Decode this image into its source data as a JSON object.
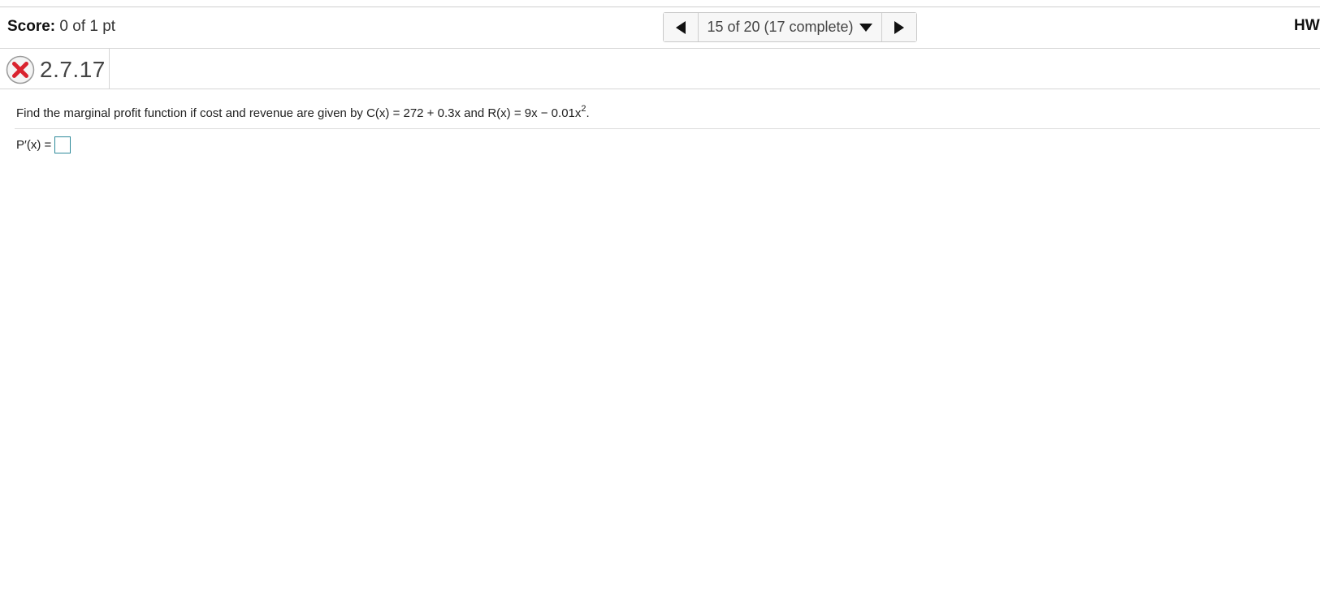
{
  "header": {
    "score_label": "Score:",
    "score_value": "0 of 1 pt",
    "nav": {
      "position_text": "15 of 20 (17 complete)"
    },
    "hw_label": "HW"
  },
  "question": {
    "status": "incorrect",
    "number": "2.7.17",
    "text_before": "Find the marginal profit function if cost and revenue are given by C(x) = 272 + 0.3x and R(x) = 9x − 0.01x",
    "exponent": "2",
    "text_after": ".",
    "answer_label": "P′(x) =",
    "answer_value": ""
  },
  "colors": {
    "incorrect_icon": "#d9232e",
    "input_border": "#2e8a9a"
  },
  "icons": {
    "prev": "triangle-left-icon",
    "next": "triangle-right-icon",
    "dropdown": "caret-down-icon",
    "status": "x-circle-icon"
  }
}
